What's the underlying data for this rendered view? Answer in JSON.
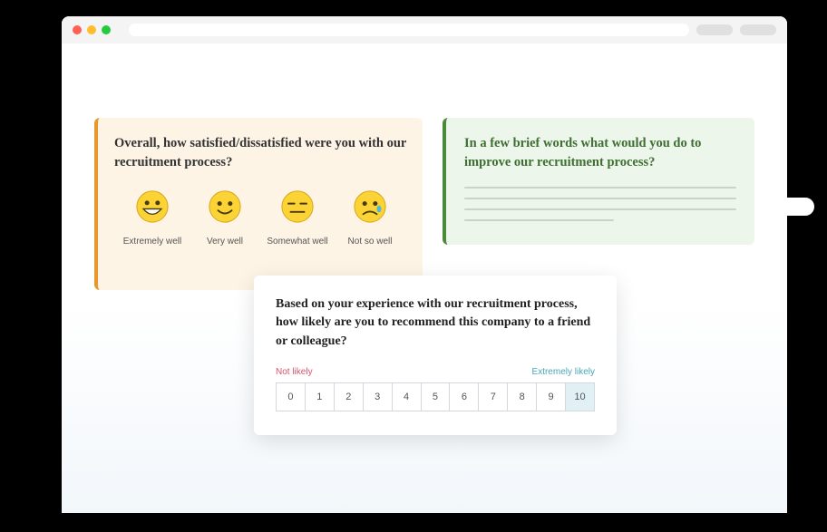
{
  "survey": {
    "satisfaction": {
      "question": "Overall, how satisfied/dissatisfied were you with our recruitment process?",
      "options": [
        {
          "label": "Extremely well",
          "emoji": "grin"
        },
        {
          "label": "Very well",
          "emoji": "smile"
        },
        {
          "label": "Somewhat well",
          "emoji": "neutral"
        },
        {
          "label": "Not so well",
          "emoji": "sad"
        }
      ]
    },
    "improvement": {
      "question": "In a few brief words what would you do to improve our recruitment process?"
    },
    "nps": {
      "question": "Based on your experience with our recruitment process, how likely are you to recommend this company to a friend or colleague?",
      "low_label": "Not likely",
      "high_label": "Extremely likely",
      "scale": [
        "0",
        "1",
        "2",
        "3",
        "4",
        "5",
        "6",
        "7",
        "8",
        "9",
        "10"
      ],
      "selected": "10"
    }
  }
}
